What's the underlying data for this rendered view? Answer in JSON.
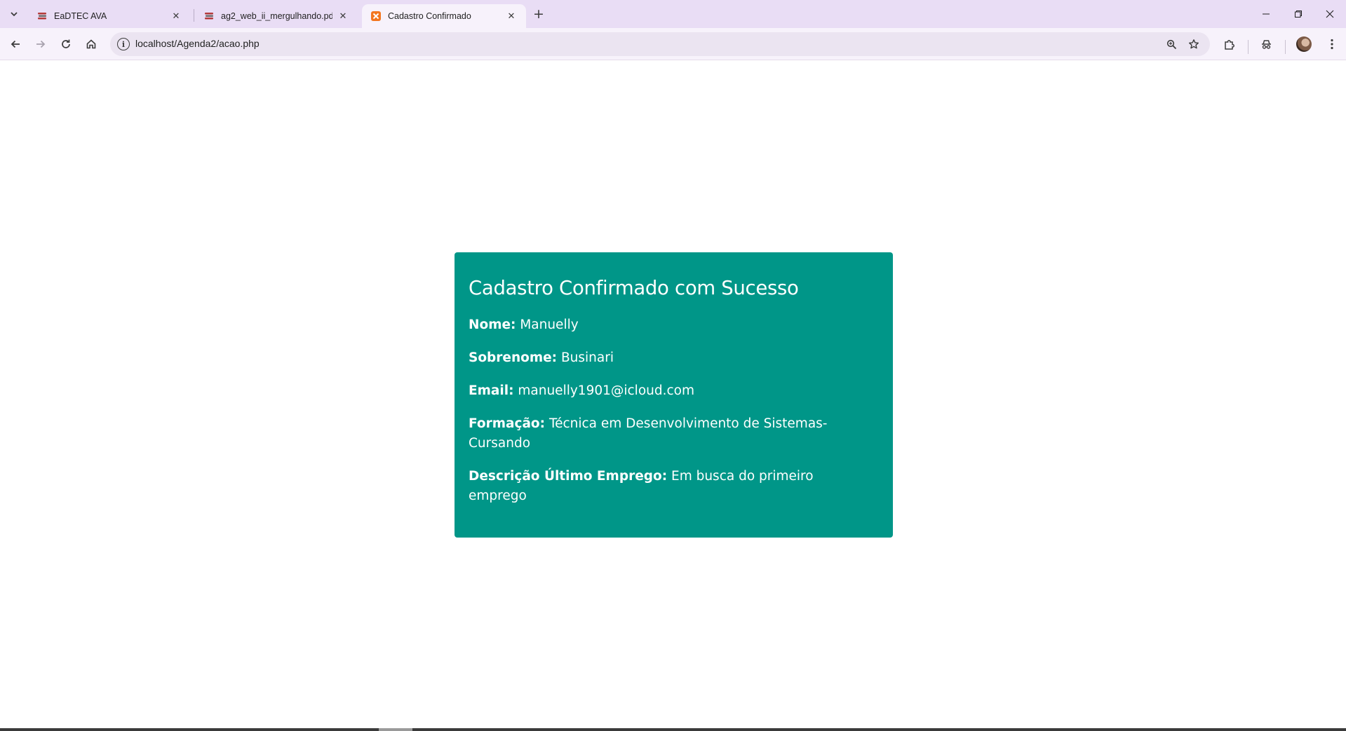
{
  "tabs": [
    {
      "title": "EaDTEC AVA",
      "favicon": "book-stack-icon",
      "active": false
    },
    {
      "title": "ag2_web_ii_mergulhando.pdf",
      "favicon": "book-stack-icon",
      "active": false
    },
    {
      "title": "Cadastro Confirmado",
      "favicon": "xampp-icon",
      "active": true
    }
  ],
  "toolbar": {
    "url": "localhost/Agenda2/acao.php"
  },
  "card": {
    "heading": "Cadastro Confirmado com Sucesso",
    "fields": [
      {
        "label": "Nome:",
        "value": "Manuelly"
      },
      {
        "label": "Sobrenome:",
        "value": "Businari"
      },
      {
        "label": "Email:",
        "value": "manuelly1901@icloud.com"
      },
      {
        "label": "Formação:",
        "value": "Técnica em Desenvolvimento de Sistemas- Cursando"
      },
      {
        "label": "Descrição Último Emprego:",
        "value": "Em busca do primeiro emprego"
      }
    ]
  },
  "colors": {
    "card_background": "#009688",
    "tabstrip_background": "#e9ddf5"
  }
}
